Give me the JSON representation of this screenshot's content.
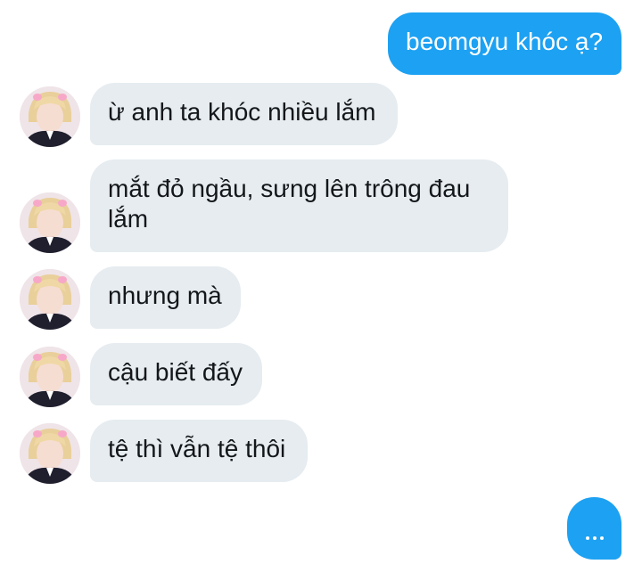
{
  "conversation": {
    "sent_message": "beomgyu khóc ạ?",
    "received_messages": [
      "ừ anh ta khóc nhiều lắm",
      "mắt đỏ ngầu, sưng lên trông đau lắm",
      "nhưng mà",
      "cậu biết đấy",
      "tệ thì vẫn tệ thôi"
    ],
    "typing_indicator": "..."
  },
  "colors": {
    "sent_bubble": "#1da1f2",
    "received_bubble": "#e6ecf0",
    "received_text": "#14171a",
    "sent_text": "#ffffff"
  },
  "icons": {
    "contact_avatar": "avatar-icon",
    "typing": "typing-indicator-icon"
  }
}
